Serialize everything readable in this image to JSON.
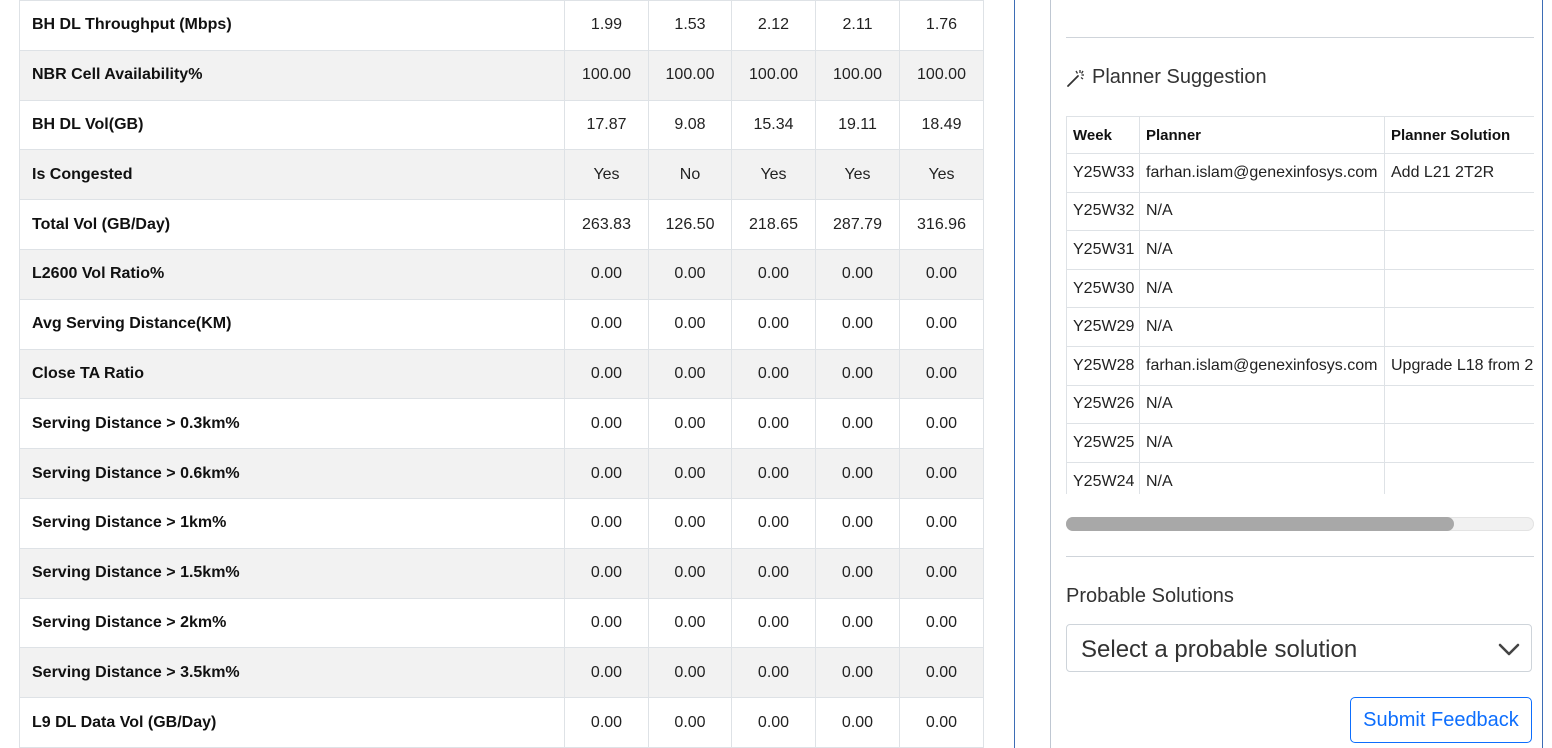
{
  "kpi_table": {
    "rows": [
      {
        "label": "BH DL Throughput (Mbps)",
        "values": [
          "1.99",
          "1.53",
          "2.12",
          "2.11",
          "1.76"
        ]
      },
      {
        "label": "NBR Cell Availability%",
        "values": [
          "100.00",
          "100.00",
          "100.00",
          "100.00",
          "100.00"
        ]
      },
      {
        "label": "BH DL Vol(GB)",
        "values": [
          "17.87",
          "9.08",
          "15.34",
          "19.11",
          "18.49"
        ]
      },
      {
        "label": "Is Congested",
        "values": [
          "Yes",
          "No",
          "Yes",
          "Yes",
          "Yes"
        ]
      },
      {
        "label": "Total Vol (GB/Day)",
        "values": [
          "263.83",
          "126.50",
          "218.65",
          "287.79",
          "316.96"
        ]
      },
      {
        "label": "L2600 Vol Ratio%",
        "values": [
          "0.00",
          "0.00",
          "0.00",
          "0.00",
          "0.00"
        ]
      },
      {
        "label": "Avg Serving Distance(KM)",
        "values": [
          "0.00",
          "0.00",
          "0.00",
          "0.00",
          "0.00"
        ]
      },
      {
        "label": "Close TA Ratio",
        "values": [
          "0.00",
          "0.00",
          "0.00",
          "0.00",
          "0.00"
        ]
      },
      {
        "label": "Serving Distance > 0.3km%",
        "values": [
          "0.00",
          "0.00",
          "0.00",
          "0.00",
          "0.00"
        ]
      },
      {
        "label": "Serving Distance > 0.6km%",
        "values": [
          "0.00",
          "0.00",
          "0.00",
          "0.00",
          "0.00"
        ]
      },
      {
        "label": "Serving Distance > 1km%",
        "values": [
          "0.00",
          "0.00",
          "0.00",
          "0.00",
          "0.00"
        ]
      },
      {
        "label": "Serving Distance > 1.5km%",
        "values": [
          "0.00",
          "0.00",
          "0.00",
          "0.00",
          "0.00"
        ]
      },
      {
        "label": "Serving Distance > 2km%",
        "values": [
          "0.00",
          "0.00",
          "0.00",
          "0.00",
          "0.00"
        ]
      },
      {
        "label": "Serving Distance > 3.5km%",
        "values": [
          "0.00",
          "0.00",
          "0.00",
          "0.00",
          "0.00"
        ]
      },
      {
        "label": "L9 DL Data Vol (GB/Day)",
        "values": [
          "0.00",
          "0.00",
          "0.00",
          "0.00",
          "0.00"
        ]
      }
    ]
  },
  "planner_suggestion": {
    "title": "Planner Suggestion",
    "icon": "magic-wand-icon",
    "headers": [
      "Week",
      "Planner",
      "Planner Solution"
    ],
    "rows": [
      {
        "week": "Y25W33",
        "planner": "farhan.islam@genexinfosys.com",
        "solution": "Add L21 2T2R"
      },
      {
        "week": "Y25W32",
        "planner": "N/A",
        "solution": ""
      },
      {
        "week": "Y25W31",
        "planner": "N/A",
        "solution": ""
      },
      {
        "week": "Y25W30",
        "planner": "N/A",
        "solution": ""
      },
      {
        "week": "Y25W29",
        "planner": "N/A",
        "solution": ""
      },
      {
        "week": "Y25W28",
        "planner": "farhan.islam@genexinfosys.com",
        "solution": "Upgrade L18 from 2"
      },
      {
        "week": "Y25W26",
        "planner": "N/A",
        "solution": ""
      },
      {
        "week": "Y25W25",
        "planner": "N/A",
        "solution": ""
      },
      {
        "week": "Y25W24",
        "planner": "N/A",
        "solution": ""
      }
    ],
    "horizontal_scroll_fraction": 0.83
  },
  "probable_solutions": {
    "label": "Probable Solutions",
    "select_placeholder": "Select a probable solution"
  },
  "submit_label": "Submit Feedback",
  "colors": {
    "accent": "#0d6efd",
    "divider": "#3d6db5",
    "row_alt": "#f2f2f2"
  }
}
